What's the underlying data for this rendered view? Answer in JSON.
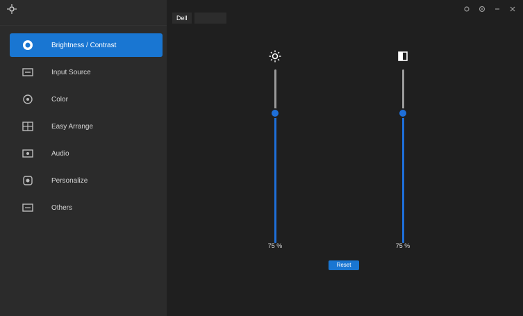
{
  "sidebar": {
    "items": [
      {
        "label": "Brightness / Contrast",
        "icon": "brightness-icon",
        "active": true
      },
      {
        "label": "Input Source",
        "icon": "input-source-icon",
        "active": false
      },
      {
        "label": "Color",
        "icon": "color-icon",
        "active": false
      },
      {
        "label": "Easy Arrange",
        "icon": "easy-arrange-icon",
        "active": false
      },
      {
        "label": "Audio",
        "icon": "audio-icon",
        "active": false
      },
      {
        "label": "Personalize",
        "icon": "personalize-icon",
        "active": false
      },
      {
        "label": "Others",
        "icon": "others-icon",
        "active": false
      }
    ]
  },
  "tabs": [
    {
      "label": "Dell"
    },
    {
      "label": ""
    }
  ],
  "sliders": [
    {
      "name": "brightness",
      "value_text": "75 %",
      "level": 0.75,
      "icon": "brightness-icon"
    },
    {
      "name": "contrast",
      "value_text": "75 %",
      "level": 0.75,
      "icon": "contrast-icon"
    }
  ],
  "buttons": {
    "reset": "Reset"
  },
  "colors": {
    "accent": "#1976d2",
    "sidebar": "#2b2b2b",
    "main": "#1f1f1f"
  }
}
